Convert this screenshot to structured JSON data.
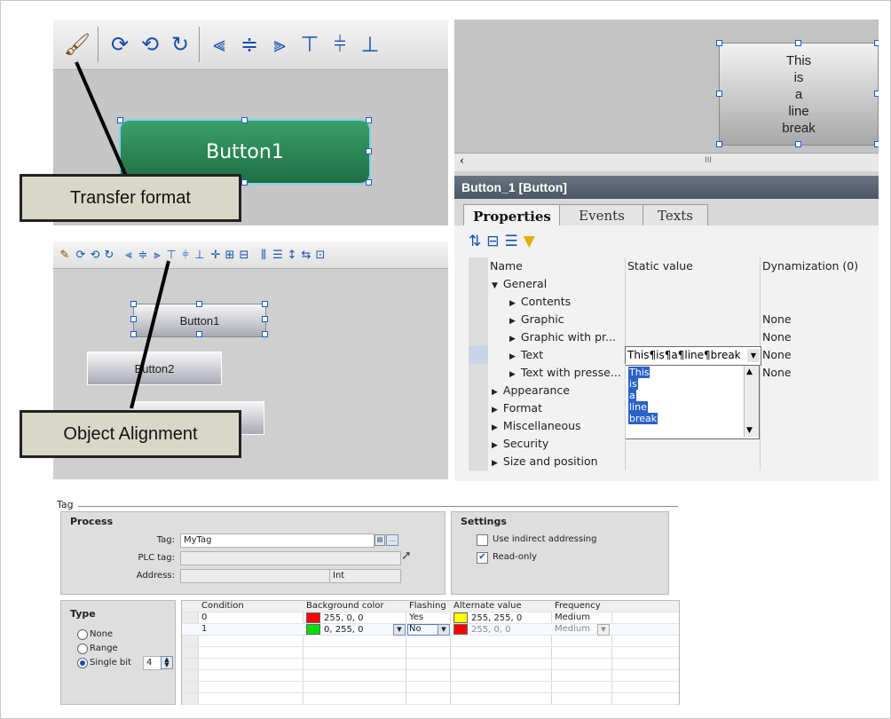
{
  "panel_a": {
    "button_label": "Button1",
    "toolbar_icons": [
      "brush-icon",
      "rotate-right-icon",
      "rotate-left-icon",
      "rotate-icon",
      "align-left-icon",
      "align-center-icon",
      "align-right-icon",
      "align-top-icon",
      "align-middle-icon",
      "align-bottom-icon"
    ]
  },
  "panel_b": {
    "preview_button_text": "This\nis\na\nline\nbreak",
    "scrollbar_grip": "III",
    "title": "Button_1 [Button]",
    "tabs": [
      "Properties",
      "Events",
      "Texts"
    ],
    "columns": {
      "name": "Name",
      "static": "Static value",
      "dyn": "Dynamization (0)"
    },
    "rows": [
      {
        "name": "General",
        "level": 0,
        "open": true,
        "static": "",
        "dyn": ""
      },
      {
        "name": "Contents",
        "level": 1,
        "static": "",
        "dyn": ""
      },
      {
        "name": "Graphic",
        "level": 1,
        "static": "",
        "dyn": "None"
      },
      {
        "name": "Graphic with pr...",
        "level": 1,
        "static": "",
        "dyn": "None"
      },
      {
        "name": "Text",
        "level": 1,
        "static": "This¶is¶a¶line¶break",
        "dyn": "None"
      },
      {
        "name": "Text with presse...",
        "level": 1,
        "static": "",
        "dyn": "None"
      },
      {
        "name": "Appearance",
        "level": 0,
        "static": "",
        "dyn": ""
      },
      {
        "name": "Format",
        "level": 0,
        "static": "",
        "dyn": ""
      },
      {
        "name": "Miscellaneous",
        "level": 0,
        "static": "",
        "dyn": ""
      },
      {
        "name": "Security",
        "level": 0,
        "static": "",
        "dyn": ""
      },
      {
        "name": "Size and position",
        "level": 0,
        "static": "",
        "dyn": ""
      }
    ],
    "dropdown_lines": [
      "This",
      "is",
      "a",
      "line",
      "break"
    ]
  },
  "panel_c": {
    "buttons": [
      "Button1",
      "Button2"
    ]
  },
  "callouts": {
    "transfer": "Transfer format",
    "alignment": "Object Alignment"
  },
  "tag_dialog": {
    "title": "Tag",
    "process": {
      "header": "Process",
      "tag_label": "Tag:",
      "tag_value": "MyTag",
      "plc_label": "PLC tag:",
      "address_label": "Address:",
      "address_type": "Int"
    },
    "settings": {
      "header": "Settings",
      "indirect": "Use indirect addressing",
      "readonly": "Read-only"
    },
    "type": {
      "header": "Type",
      "options": [
        "None",
        "Range",
        "Single bit"
      ],
      "bit_value": "4"
    },
    "table": {
      "headers": [
        "Condition",
        "Background color",
        "Flashing",
        "Alternate value",
        "Frequency"
      ],
      "rows": [
        {
          "condition": "0",
          "bg": "255, 0, 0",
          "bg_color": "#ff0000",
          "flashing": "Yes",
          "alt": "255, 255, 0",
          "alt_color": "#ffff00",
          "freq": "Medium"
        },
        {
          "condition": "1",
          "bg": "0, 255, 0",
          "bg_color": "#00dd00",
          "flashing": "No",
          "alt": "255, 0, 0",
          "alt_color": "#ff0000",
          "freq": "Medium"
        }
      ]
    }
  }
}
